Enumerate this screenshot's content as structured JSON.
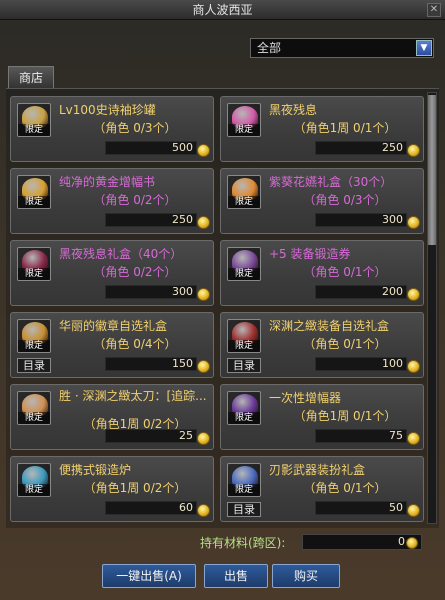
{
  "window": {
    "title": "商人波西亚"
  },
  "filter": {
    "selected": "全部"
  },
  "tabs": {
    "shop": "商店"
  },
  "common": {
    "tag": "限定",
    "catalog": "目录"
  },
  "items": [
    {
      "name": "Lv100史诗袖珍罐",
      "limit": "（角色 0/3个）",
      "price": "500",
      "color": "gold",
      "icon_color": "#c9a040",
      "icon_name": "jar-icon",
      "catalog": false
    },
    {
      "name": "黑夜残息",
      "limit": "（角色1周 0/1个）",
      "price": "250",
      "color": "gold",
      "icon_color": "#d25aa8",
      "icon_name": "orb-icon",
      "catalog": false
    },
    {
      "name": "纯净的黄金增幅书",
      "limit": "（角色 0/2个）",
      "price": "250",
      "color": "purple",
      "icon_color": "#d8a030",
      "icon_name": "book-icon",
      "catalog": false
    },
    {
      "name": "紫葵花嬿礼盒（30个）",
      "limit": "（角色 0/3个）",
      "price": "300",
      "color": "purple",
      "icon_color": "#e08a30",
      "icon_name": "flower-box-icon",
      "catalog": false
    },
    {
      "name": "黑夜残息礼盒（40个）",
      "limit": "（角色 0/2个）",
      "price": "300",
      "color": "purple",
      "icon_color": "#8a2a4a",
      "icon_name": "gift-box-icon",
      "catalog": false
    },
    {
      "name": "+5 装备锻造券",
      "limit": "（角色 0/1个）",
      "price": "200",
      "color": "purple",
      "icon_color": "#7a4a9a",
      "icon_name": "ticket-icon",
      "catalog": false
    },
    {
      "name": "华丽的徽章自选礼盒",
      "limit": "（角色 0/4个）",
      "price": "150",
      "color": "gold",
      "icon_color": "#c89030",
      "icon_name": "badge-box-icon",
      "catalog": true
    },
    {
      "name": "深渊之緻装备自选礼盒",
      "limit": "（角色 0/1个）",
      "price": "100",
      "color": "gold",
      "icon_color": "#a03030",
      "icon_name": "abyss-box-icon",
      "catalog": true
    },
    {
      "name": "胜 · 深渊之緻太刀：[追踪...",
      "limit": "（角色1周 0/2个）",
      "price": "25",
      "color": "gold",
      "icon_color": "#d09050",
      "icon_name": "sword-icon",
      "catalog": false
    },
    {
      "name": "一次性增幅器",
      "limit": "（角色1周 0/1个）",
      "price": "75",
      "color": "gold",
      "icon_color": "#6a3a9a",
      "icon_name": "amplifier-icon",
      "catalog": false
    },
    {
      "name": "便携式锻造炉",
      "limit": "（角色1周 0/2个）",
      "price": "60",
      "color": "gold",
      "icon_color": "#3a9ac0",
      "icon_name": "furnace-icon",
      "catalog": false
    },
    {
      "name": "刃影武器装扮礼盒",
      "limit": "（角色 0/1个）",
      "price": "50",
      "color": "gold",
      "icon_color": "#4a6ac0",
      "icon_name": "weapon-avatar-box-icon",
      "catalog": true
    }
  ],
  "materials": {
    "label": "持有材料(跨区):",
    "value": "0"
  },
  "buttons": {
    "sell_all": "一键出售(A)",
    "sell": "出售",
    "buy": "购买"
  },
  "colors": {
    "gold_text": "#f1d06e",
    "purple_text": "#d86ad8",
    "button_blue": "#2e5a9a"
  }
}
